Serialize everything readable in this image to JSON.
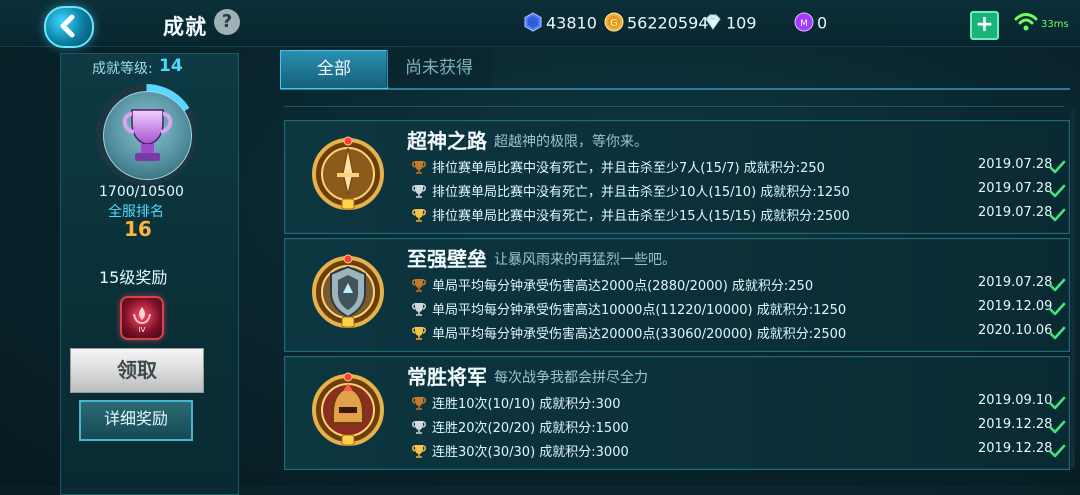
{
  "header": {
    "title": "成就",
    "help_label": "?",
    "currencies": [
      {
        "name": "gem",
        "value": "43810",
        "icon": "hexagon-gem-icon",
        "color": "#5b8cff"
      },
      {
        "name": "gold",
        "value": "56220594",
        "icon": "gold-coin-icon",
        "color": "#f4b23a"
      },
      {
        "name": "diamond",
        "value": "109",
        "icon": "diamond-icon",
        "color": "#e9f8ff"
      },
      {
        "name": "token",
        "value": "0",
        "icon": "purple-token-icon",
        "color": "#c04bff"
      }
    ],
    "plus_label": "+",
    "ping": "33ms"
  },
  "left": {
    "achievement_level_label": "成就等级:",
    "achievement_level_value": "14",
    "progress_text": "1700/10500",
    "progress_fraction": 0.162,
    "server_rank_label": "全服排名",
    "server_rank_value": "16",
    "reward_title": "15级奖励",
    "claim_label": "领取",
    "detail_label": "详细奖励"
  },
  "tabs": [
    {
      "label": "全部",
      "active": true
    },
    {
      "label": "尚未获得",
      "active": false
    }
  ],
  "cards": [
    {
      "title": "超神之路",
      "desc": "超越神的极限，等你来。",
      "rows": [
        {
          "trophy": "bronze",
          "text": "排位赛单局比赛中没有死亡，并且击杀至少7人(15/7) 成就积分:250",
          "date": "2019.07.28"
        },
        {
          "trophy": "silver",
          "text": "排位赛单局比赛中没有死亡，并且击杀至少10人(15/10) 成就积分:1250",
          "date": "2019.07.28"
        },
        {
          "trophy": "gold",
          "text": "排位赛单局比赛中没有死亡，并且击杀至少15人(15/15) 成就积分:2500",
          "date": "2019.07.28"
        }
      ],
      "icon": "sword-badge-icon"
    },
    {
      "title": "至强壁垒",
      "desc": "让暴风雨来的再猛烈一些吧。",
      "rows": [
        {
          "trophy": "bronze",
          "text": "单局平均每分钟承受伤害高达2000点(2880/2000) 成就积分:250",
          "date": "2019.07.28"
        },
        {
          "trophy": "silver",
          "text": "单局平均每分钟承受伤害高达10000点(11220/10000) 成就积分:1250",
          "date": "2019.12.09"
        },
        {
          "trophy": "gold",
          "text": "单局平均每分钟承受伤害高达20000点(33060/20000) 成就积分:2500",
          "date": "2020.10.06"
        }
      ],
      "icon": "shield-badge-icon"
    },
    {
      "title": "常胜将军",
      "desc": "每次战争我都会拼尽全力",
      "rows": [
        {
          "trophy": "bronze",
          "text": "连胜10次(10/10) 成就积分:300",
          "date": "2019.09.10"
        },
        {
          "trophy": "silver",
          "text": "连胜20次(20/20) 成就积分:1500",
          "date": "2019.12.28"
        },
        {
          "trophy": "gold",
          "text": "连胜30次(30/30) 成就积分:3000",
          "date": "2019.12.28"
        }
      ],
      "icon": "helmet-badge-icon"
    }
  ]
}
